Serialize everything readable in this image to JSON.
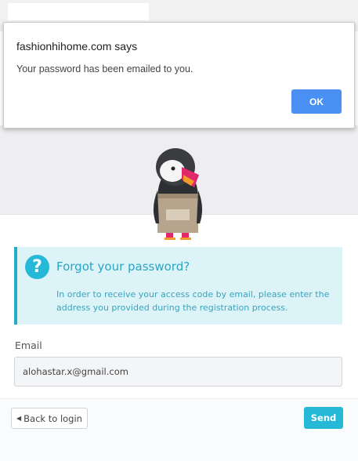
{
  "dialog": {
    "title": "fashionhihome.com says",
    "message": "Your password has been emailed to you.",
    "ok_label": "OK"
  },
  "alert": {
    "icon": "?",
    "title": "Forgot your password?",
    "body": "In order to receive your access code by email, please enter the address you provided during the registration process."
  },
  "form": {
    "email_label": "Email",
    "email_value": "alohastar.x@gmail.com"
  },
  "footer": {
    "back_label": "Back to login",
    "send_label": "Send"
  },
  "colors": {
    "accent": "#25b9d7",
    "ok_button": "#4a8ff3"
  }
}
